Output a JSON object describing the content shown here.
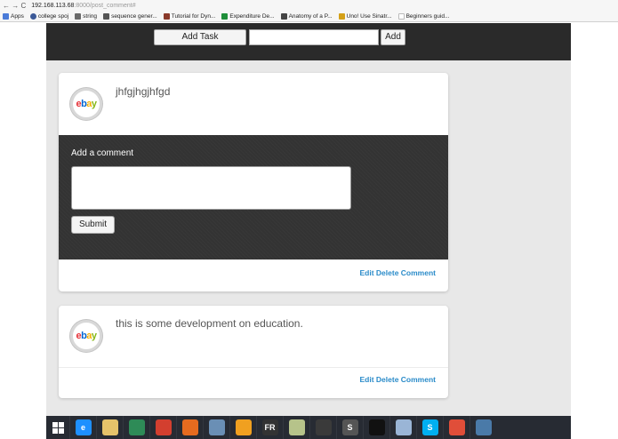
{
  "browser": {
    "nav": "← → C",
    "url_host": "192.168.113.68",
    "url_path": ":8000/post_comment#",
    "bookmarks": [
      {
        "label": "Apps",
        "color": "#4a7bd8"
      },
      {
        "label": "college spoj",
        "color": "#3b5998"
      },
      {
        "label": "string",
        "color": "#6a6a6a"
      },
      {
        "label": "sequence gener...",
        "color": "#555555"
      },
      {
        "label": "Tutorial for Dyn...",
        "color": "#8a3a2a"
      },
      {
        "label": "Expenditure De...",
        "color": "#1f8f3a"
      },
      {
        "label": "Anatomy of a P...",
        "color": "#444444"
      },
      {
        "label": "Uno! Use Sinatr...",
        "color": "#d4a017"
      },
      {
        "label": "Beginners guid...",
        "color": "#cccccc"
      }
    ]
  },
  "toolbar": {
    "add_task_label": "Add Task",
    "task_input_value": "",
    "add_label": "Add"
  },
  "posts": [
    {
      "text": "jhfgjhgjhfgd",
      "avatar_text": "ebay",
      "comment_label": "Add a comment",
      "comment_value": "",
      "submit_label": "Submit",
      "actions": {
        "edit": "Edit",
        "delete": "Delete",
        "comment": "Comment"
      }
    },
    {
      "text": "this is some development on education.",
      "avatar_text": "ebay",
      "actions": {
        "edit": "Edit",
        "delete": "Delete",
        "comment": "Comment"
      }
    }
  ],
  "taskbar": {
    "icons": [
      {
        "name": "internet-explorer-icon",
        "glyph": "e",
        "color": "#1e90ff"
      },
      {
        "name": "file-explorer-icon",
        "glyph": "",
        "color": "#e6c36a"
      },
      {
        "name": "store-icon",
        "glyph": "",
        "color": "#2e8b57"
      },
      {
        "name": "chrome-icon",
        "glyph": "",
        "color": "#d33f2f"
      },
      {
        "name": "firefox-icon",
        "glyph": "",
        "color": "#e66b1f"
      },
      {
        "name": "network-icon",
        "glyph": "",
        "color": "#6a8fb5"
      },
      {
        "name": "app-orange-icon",
        "glyph": "",
        "color": "#f0a020"
      },
      {
        "name": "fr-app-icon",
        "glyph": "FR",
        "color": "#333333"
      },
      {
        "name": "folder-app-icon",
        "glyph": "",
        "color": "#b6c38a"
      },
      {
        "name": "console-icon",
        "glyph": "",
        "color": "#3a3a3a"
      },
      {
        "name": "sublime-icon",
        "glyph": "S",
        "color": "#555555"
      },
      {
        "name": "terminal-icon",
        "glyph": "",
        "color": "#111111"
      },
      {
        "name": "document-icon",
        "glyph": "",
        "color": "#9ab5d6"
      },
      {
        "name": "skype-icon",
        "glyph": "S",
        "color": "#00aff0"
      },
      {
        "name": "git-icon",
        "glyph": "",
        "color": "#e04e39"
      },
      {
        "name": "remote-icon",
        "glyph": "",
        "color": "#4a7aa8"
      }
    ]
  }
}
